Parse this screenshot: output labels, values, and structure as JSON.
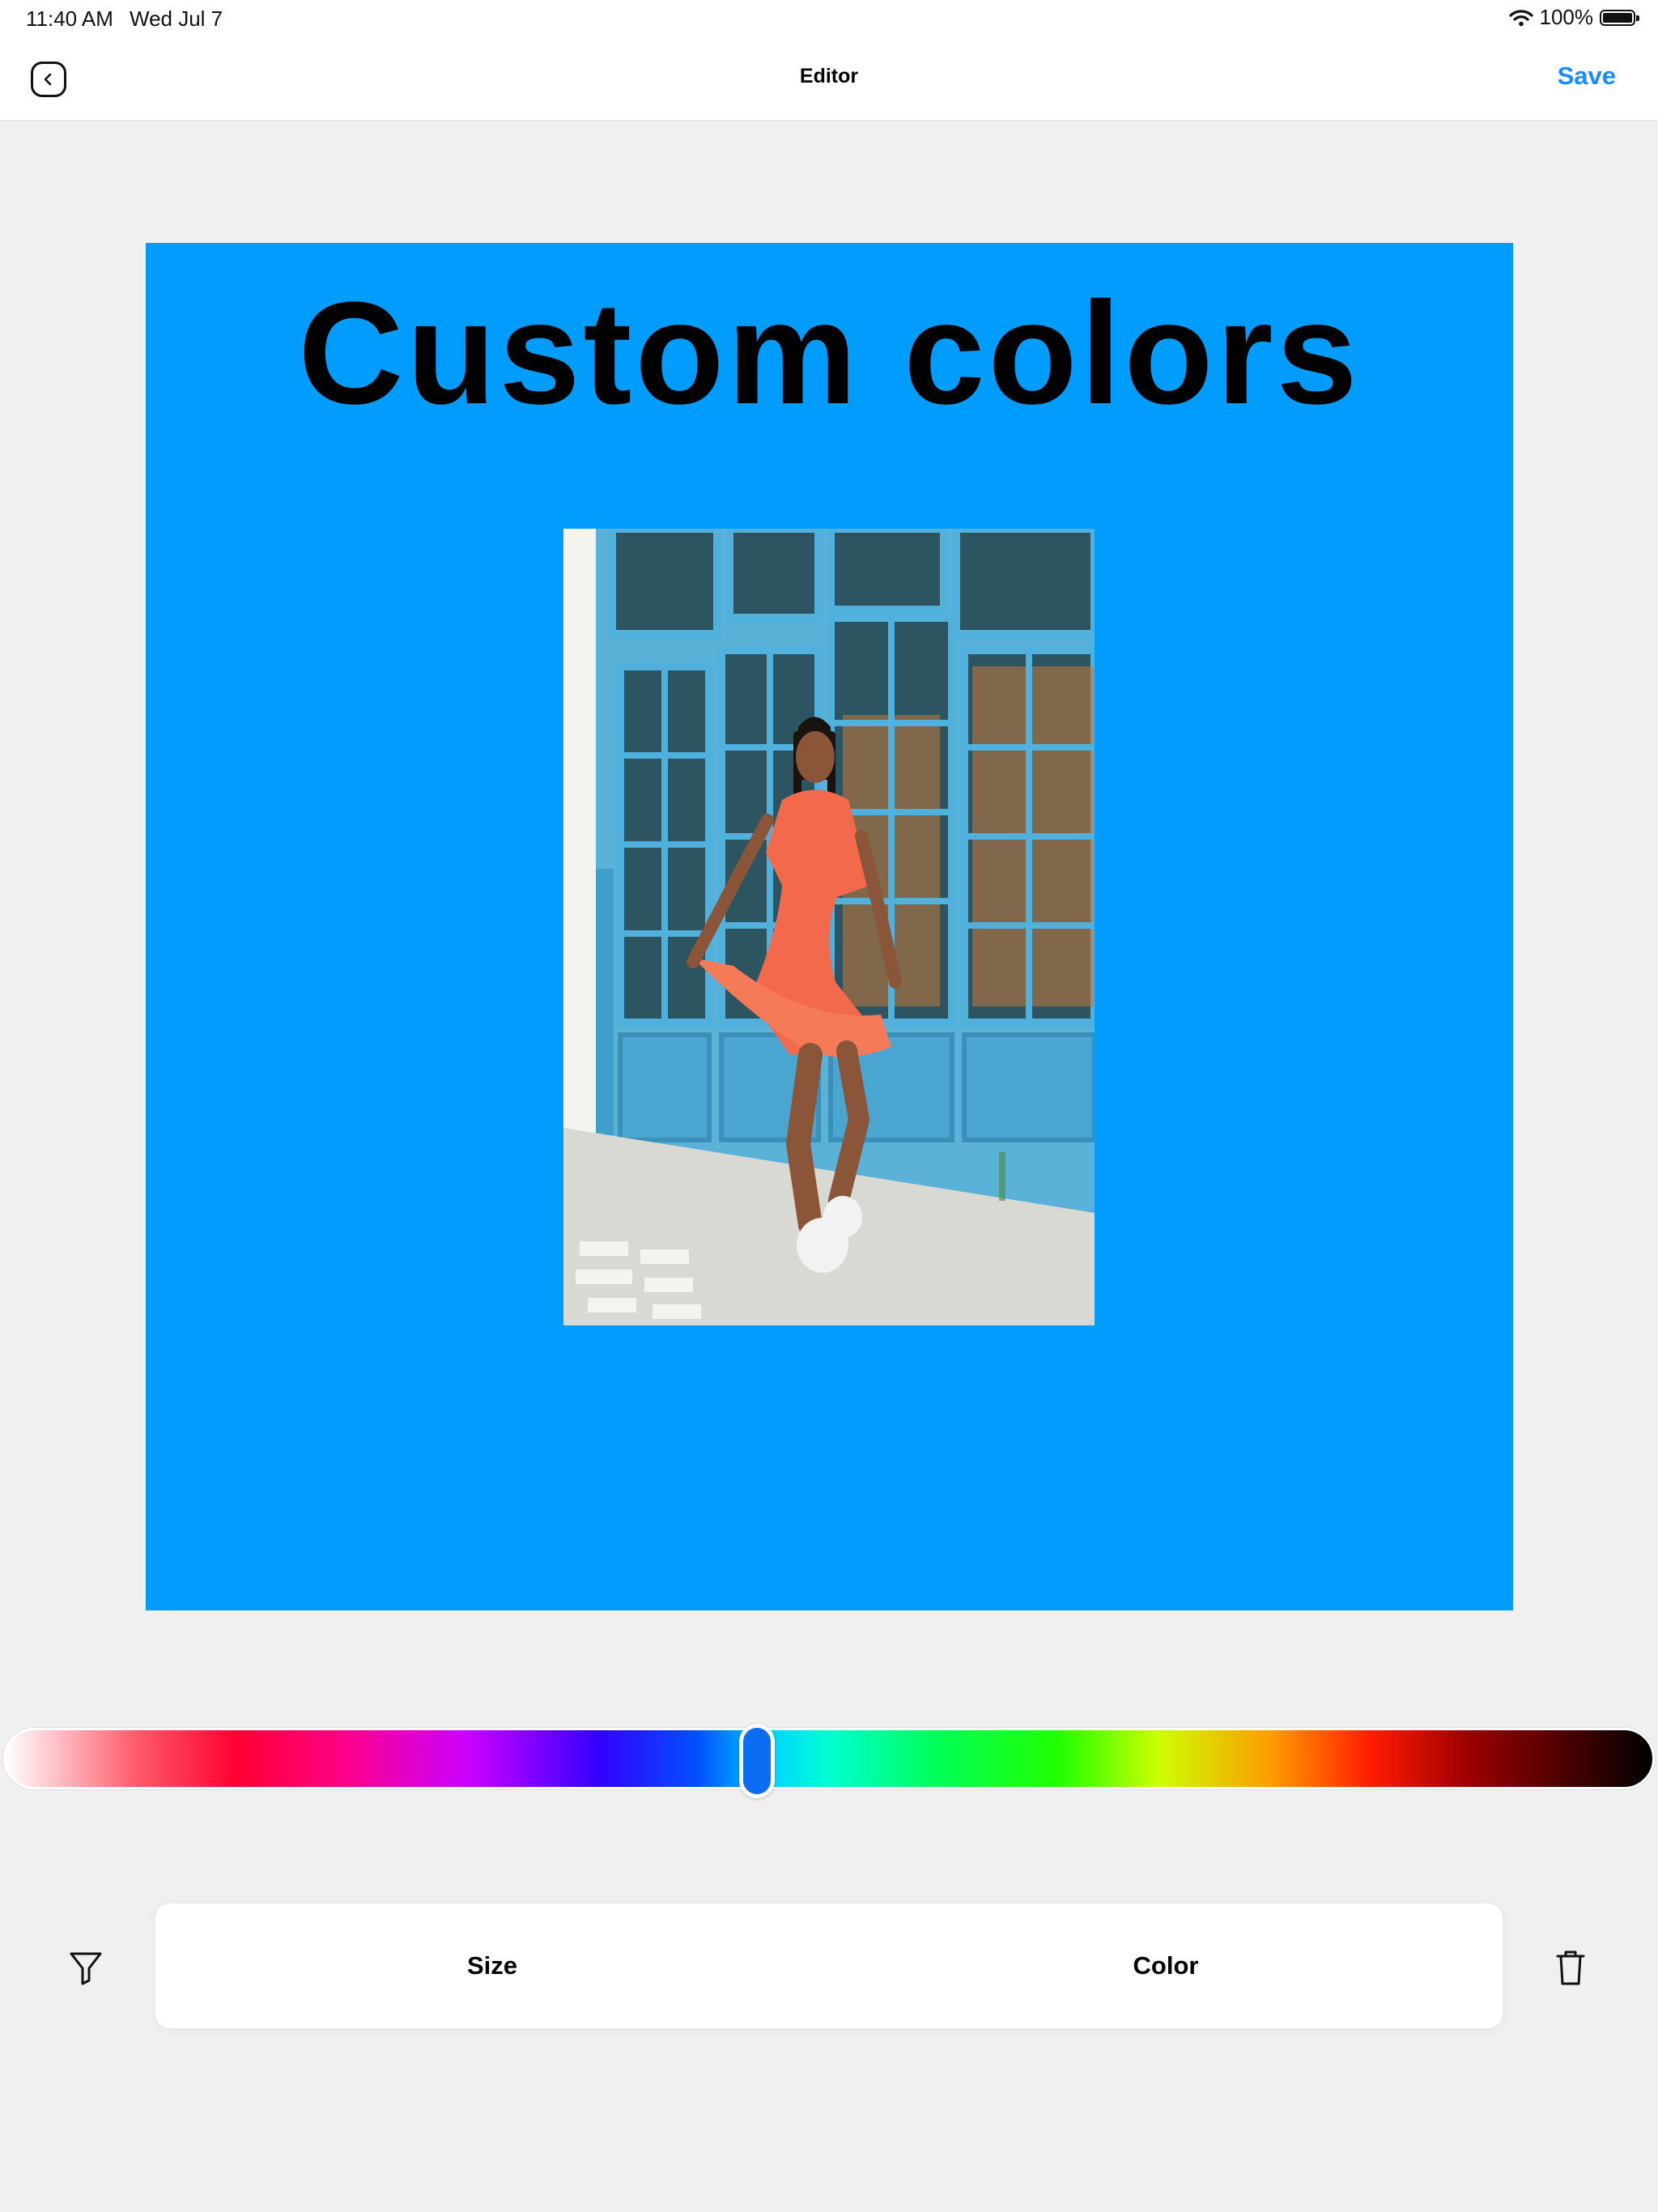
{
  "status_bar": {
    "time": "11:40 AM",
    "date": "Wed Jul 7",
    "battery": "100%",
    "icons": [
      "wifi-icon",
      "battery-icon"
    ]
  },
  "nav": {
    "back_icon": "chevron-left-icon",
    "title": "Editor",
    "save_label": "Save"
  },
  "canvas": {
    "background_color": "#009dff",
    "title": "Custom colors",
    "photo_description": "photo"
  },
  "color_slider": {
    "value": 0.456,
    "thumb_color": "#0d6df2"
  },
  "toolbar": {
    "filter_icon": "filter-icon",
    "tabs": [
      {
        "label": "Size"
      },
      {
        "label": "Color"
      }
    ],
    "delete_icon": "trash-icon"
  },
  "colors": {
    "accent": "#1a8cff",
    "canvas_background": "#009dff",
    "app_background": "#f0f0f0"
  }
}
